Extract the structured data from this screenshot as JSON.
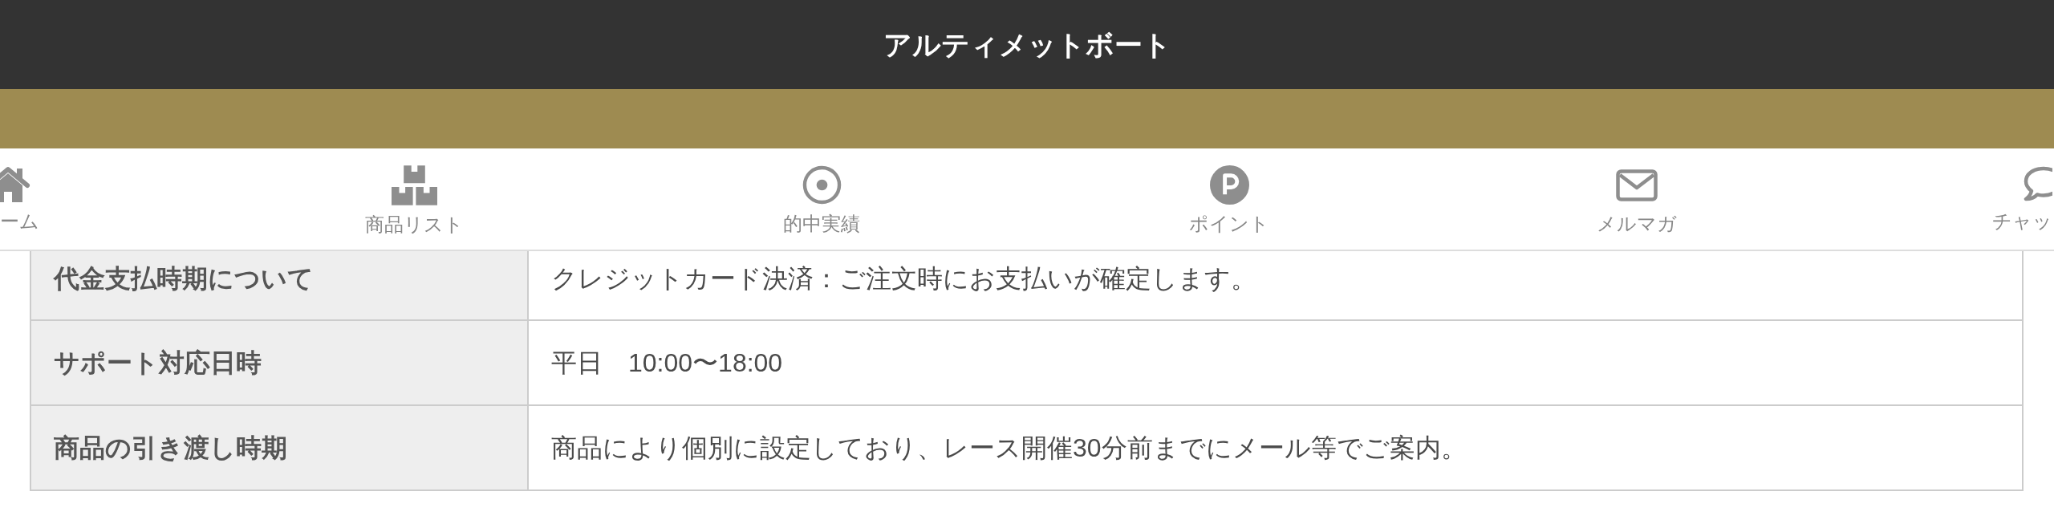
{
  "header": {
    "title": "アルティメットボート"
  },
  "nav": {
    "items": [
      {
        "label": "ーム"
      },
      {
        "label": "商品リスト"
      },
      {
        "label": "的中実績"
      },
      {
        "label": "ポイント"
      },
      {
        "label": "メルマガ"
      },
      {
        "label": "チャッ"
      }
    ]
  },
  "table": {
    "rows": [
      {
        "heading": "代金支払時期について",
        "value": "クレジットカード決済：ご注文時にお支払いが確定します。"
      },
      {
        "heading": "サポート対応日時",
        "value": "平日　10:00〜18:00"
      },
      {
        "heading": "商品の引き渡し時期",
        "value": "商品により個別に設定しており、レース開催30分前までにメール等でご案内。"
      }
    ]
  }
}
